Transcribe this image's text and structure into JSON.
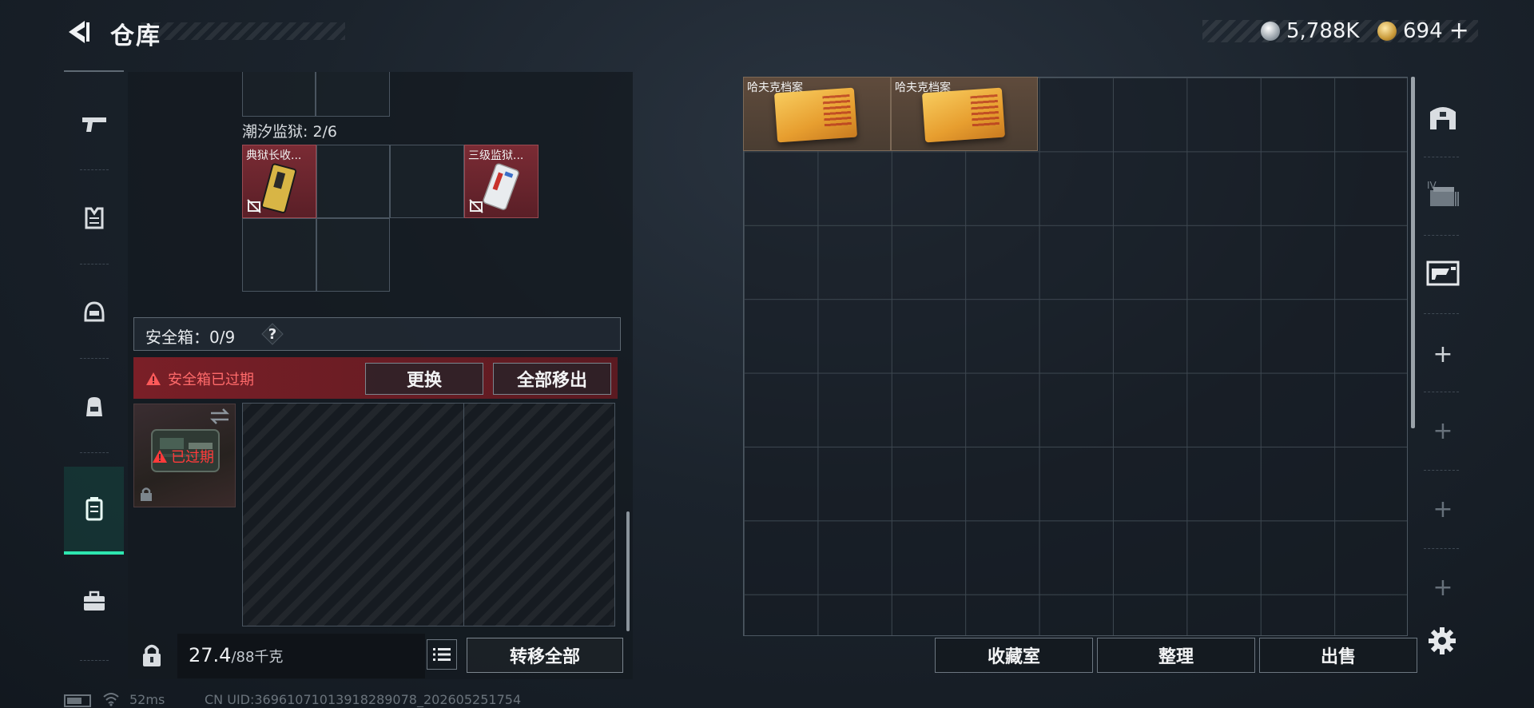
{
  "header": {
    "title": "仓库",
    "currency": [
      {
        "icon": "silver-coin-icon",
        "value": "5,788K"
      },
      {
        "icon": "gold-coin-icon",
        "value": "694"
      }
    ],
    "add_label": "+"
  },
  "left_nav": {
    "items": [
      {
        "icon": "pistol-icon"
      },
      {
        "icon": "armor-vest-icon"
      },
      {
        "icon": "helmet-icon"
      },
      {
        "icon": "backpack-icon"
      },
      {
        "icon": "safe-case-icon",
        "active": true
      },
      {
        "icon": "briefcase-icon"
      }
    ]
  },
  "container": {
    "prison_label": "潮汐监狱: 2/6",
    "items": [
      {
        "label": "典狱长收...",
        "icon": "card-icon"
      },
      {
        "label": "三级监狱...",
        "icon": "keycard-icon"
      }
    ]
  },
  "safe": {
    "label": "安全箱：0/9",
    "help": "?",
    "expired_text": "安全箱已过期",
    "replace_button": "更换",
    "move_all_button": "全部移出",
    "thumb_expired": "已过期"
  },
  "footer": {
    "weight_current": "27.4",
    "weight_max": "/88千克",
    "transfer_all": "转移全部"
  },
  "warehouse": {
    "items": [
      {
        "label": "哈夫克档案"
      },
      {
        "label": "哈夫克档案"
      }
    ],
    "buttons": {
      "collection": "收藏室",
      "sort": "整理",
      "sell": "出售"
    }
  },
  "side_tabs": {
    "plus": "+"
  },
  "status_bar": {
    "ping": "52ms",
    "uid": "CN UID:36961071013918289078_202605251754"
  },
  "colors": {
    "accent": "#2ee6b0",
    "expired_red": "#ff4a4a",
    "item_red": "#6a242c",
    "item_brown": "#564536"
  }
}
